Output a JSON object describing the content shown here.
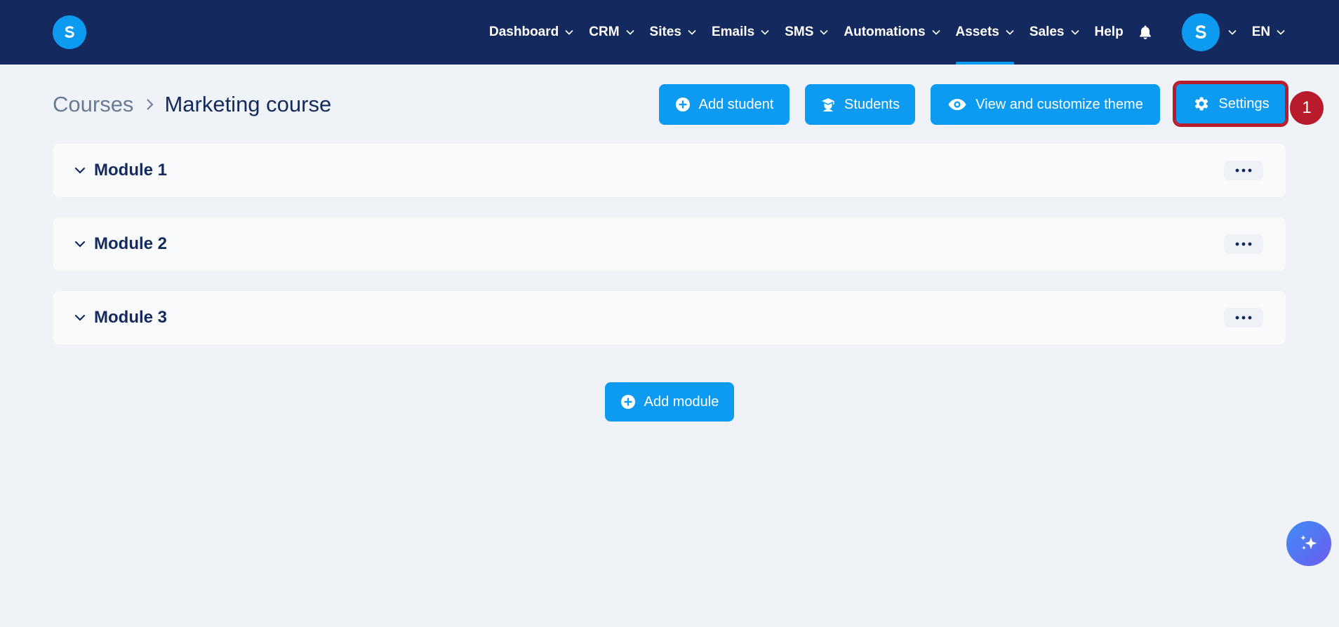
{
  "app": {
    "logo_letter": "S",
    "brand_color": "#0d9bf2",
    "header_color": "#142a5f"
  },
  "nav": {
    "items": [
      {
        "label": "Dashboard",
        "has_dropdown": true
      },
      {
        "label": "CRM",
        "has_dropdown": true
      },
      {
        "label": "Sites",
        "has_dropdown": true
      },
      {
        "label": "Emails",
        "has_dropdown": true
      },
      {
        "label": "SMS",
        "has_dropdown": true
      },
      {
        "label": "Automations",
        "has_dropdown": true
      },
      {
        "label": "Assets",
        "has_dropdown": true,
        "active": true
      },
      {
        "label": "Sales",
        "has_dropdown": true
      },
      {
        "label": "Help",
        "has_dropdown": false
      }
    ],
    "notifications_icon": "bell-icon",
    "avatar_letter": "S",
    "language": "EN"
  },
  "breadcrumb": {
    "parent": "Courses",
    "current": "Marketing course"
  },
  "actions": {
    "add_student": "Add student",
    "students": "Students",
    "view_theme": "View and customize theme",
    "settings": "Settings"
  },
  "annotation": {
    "step_number": "1",
    "color": "#b81c2c"
  },
  "modules": [
    {
      "title": "Module 1"
    },
    {
      "title": "Module 2"
    },
    {
      "title": "Module 3"
    }
  ],
  "add_module_label": "Add module",
  "ai_assistant_icon": "sparkles-icon"
}
